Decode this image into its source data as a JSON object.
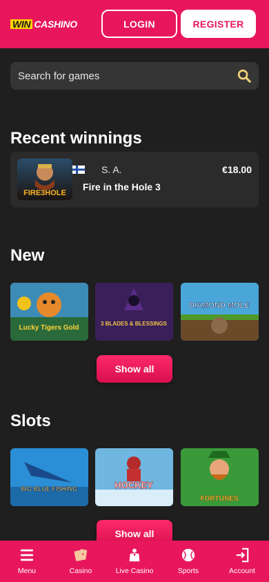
{
  "header": {
    "logo_win": "WIN",
    "logo_casino": "CASHINO",
    "login_label": "LOGIN",
    "register_label": "REGISTER"
  },
  "search": {
    "placeholder": "Search for games"
  },
  "recent": {
    "title": "Recent winnings",
    "items": [
      {
        "user": "S. A.",
        "amount": "€18.00",
        "game": "Fire in the Hole 3",
        "flag_icon": "finland-flag-icon"
      }
    ]
  },
  "new_section": {
    "title": "New",
    "games": [
      {
        "name": "Lucky Tiger's Gold",
        "label": "Lucky Tigers Gold"
      },
      {
        "name": "3 Blades & Blessings",
        "label": "3 BLADES & BLESSINGS"
      },
      {
        "name": "Diamond Mole",
        "label": "DIAMOND MOLE"
      }
    ],
    "show_all": "Show all"
  },
  "slots_section": {
    "title": "Slots",
    "games": [
      {
        "name": "Big Blue Fishing",
        "label": "BIG BLUE FISHING"
      },
      {
        "name": "Hockey",
        "label": "HOCKEY"
      },
      {
        "name": "Leprechaun Fortunes",
        "label": "FORTUNES"
      }
    ],
    "show_all": "Show all"
  },
  "bottom_nav": [
    {
      "label": "Menu",
      "icon": "menu-icon"
    },
    {
      "label": "Casino",
      "icon": "cards-icon"
    },
    {
      "label": "Live Casino",
      "icon": "dealer-icon"
    },
    {
      "label": "Sports",
      "icon": "ball-icon"
    },
    {
      "label": "Account",
      "icon": "login-icon"
    }
  ],
  "colors": {
    "brand": "#e8175d",
    "background": "#1f1f1f",
    "card": "#2b2b2b",
    "search_icon": "#f1d27a"
  }
}
